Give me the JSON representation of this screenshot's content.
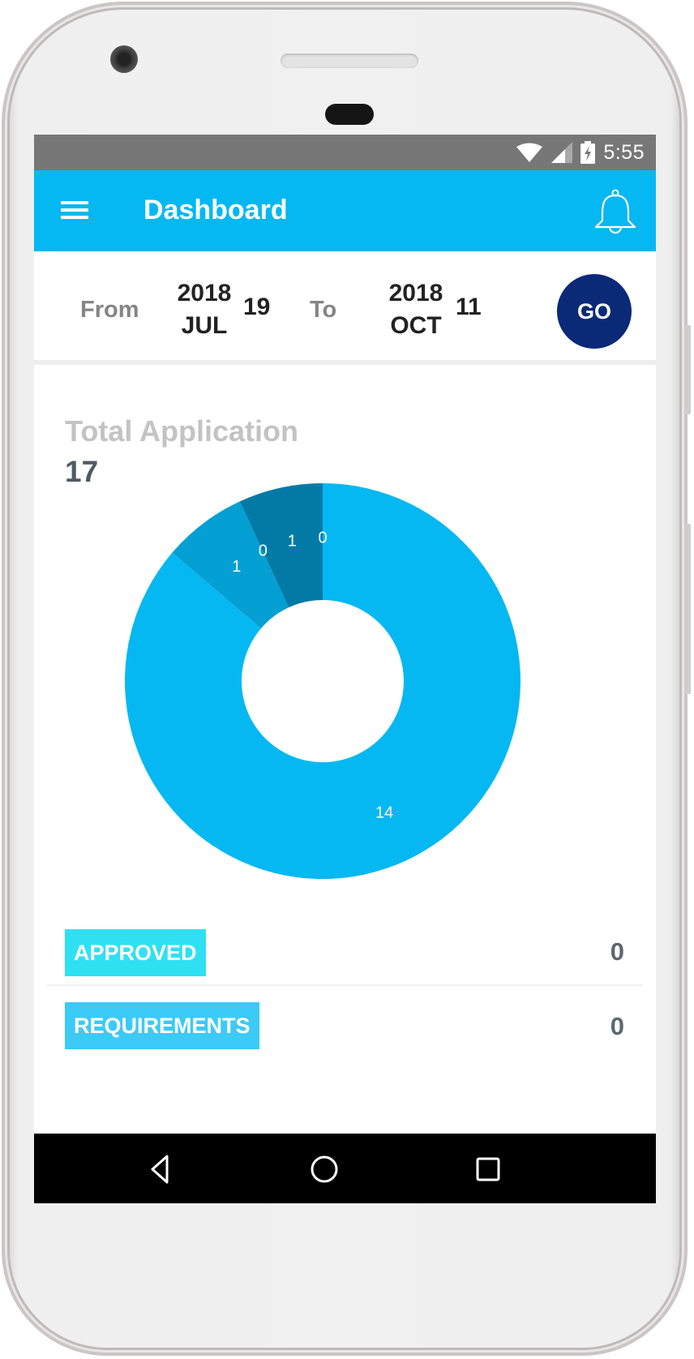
{
  "status_bar": {
    "time": "5:55",
    "icons": [
      "wifi-icon",
      "cell-signal-icon",
      "battery-charging-icon"
    ]
  },
  "app_bar": {
    "title": "Dashboard",
    "menu_icon": "hamburger-menu-icon",
    "notification_icon": "bell-icon"
  },
  "date_filter": {
    "from_label": "From",
    "from": {
      "year": "2018",
      "month": "JUL",
      "day": "19"
    },
    "to_label": "To",
    "to": {
      "year": "2018",
      "month": "OCT",
      "day": "11"
    },
    "go_label": "GO"
  },
  "summary": {
    "total_label": "Total Application",
    "total_value": "17"
  },
  "chart_data": {
    "type": "pie",
    "variant": "donut",
    "title": "",
    "total": 17,
    "slices": [
      {
        "label": "14",
        "value": 14,
        "color": "#05b8f2"
      },
      {
        "label": "1",
        "value": 1,
        "color": "#049fd3"
      },
      {
        "label": "0",
        "value": 0,
        "color": "#049fd3"
      },
      {
        "label": "1",
        "value": 1,
        "color": "#037aa6"
      },
      {
        "label": "0",
        "value": 0,
        "color": "#037aa6"
      }
    ],
    "start_angle": "top",
    "direction": "clockwise"
  },
  "status_rows": [
    {
      "label": "APPROVED",
      "count": "0",
      "color": "#2fe0f3"
    },
    {
      "label": "REQUIREMENTS",
      "count": "0",
      "color": "#3ccaf7"
    }
  ],
  "nav_bar": {
    "buttons": [
      "back-icon",
      "home-icon",
      "recents-icon"
    ]
  },
  "colors": {
    "primary": "#05b8f2",
    "go_button": "#0a2a78",
    "status_bar": "#777777"
  }
}
